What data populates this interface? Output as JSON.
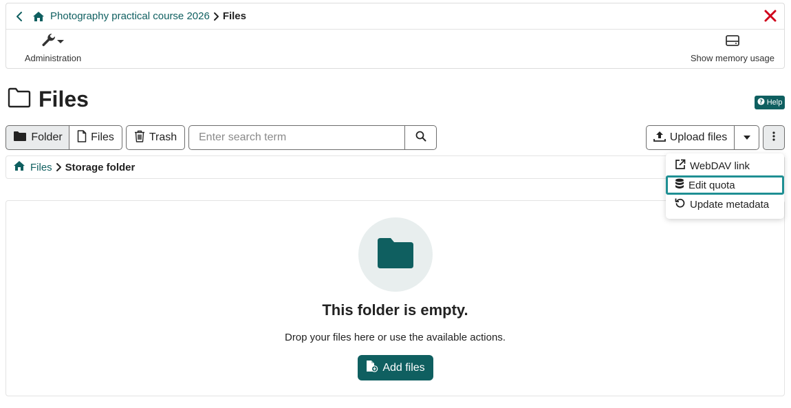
{
  "colors": {
    "brand": "#0f5f60",
    "close": "#d0021b",
    "focus": "#1e8f93"
  },
  "topbar": {
    "course": "Photography practical course 2026",
    "current": "Files",
    "tools": {
      "admin_label": "Administration",
      "memory_label": "Show memory usage"
    }
  },
  "page": {
    "title": "Files",
    "help_label": "Help"
  },
  "toolbar": {
    "folder_label": "Folder",
    "files_label": "Files",
    "trash_label": "Trash",
    "search_placeholder": "Enter search term",
    "upload_label": "Upload files"
  },
  "breadcrumb": {
    "root": "Files",
    "current": "Storage folder"
  },
  "menu": {
    "items": [
      {
        "label": "WebDAV link",
        "icon": "external-link-icon"
      },
      {
        "label": "Edit quota",
        "icon": "database-icon"
      },
      {
        "label": "Update metadata",
        "icon": "refresh-icon"
      }
    ]
  },
  "empty": {
    "title": "This folder is empty.",
    "subtitle": "Drop your files here or use the available actions.",
    "add_label": "Add files"
  }
}
